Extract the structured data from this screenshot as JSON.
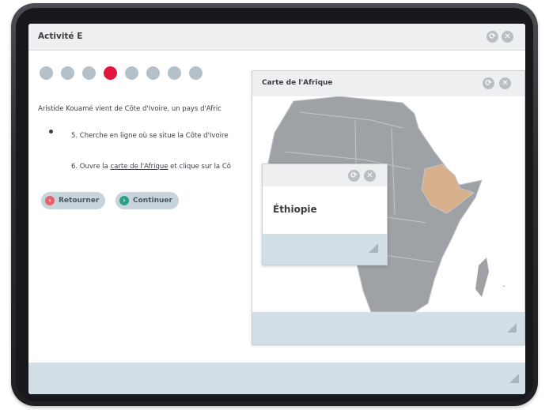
{
  "window": {
    "title": "Activité E",
    "refresh_symbol": "⟳",
    "close_symbol": "✕"
  },
  "progress": {
    "total_steps": 8,
    "current_step": 4,
    "active_color": "#e1163c",
    "inactive_color": "#b4c0ca"
  },
  "content": {
    "paragraph": "Aristide Kouamé vient de Côte d'Ivoire, un pays d'Afric",
    "step5": "5. Cherche en ligne où se situe la Côte d'Ivoire",
    "step6_prefix": "6. Ouvre la ",
    "step6_link": "carte de l'Afrique",
    "step6_suffix": " et clique sur la Cô"
  },
  "buttons": {
    "back_label": "Retourner",
    "back_icon": "back-icon",
    "back_color": "#e8606c",
    "continue_label": "Continuer",
    "continue_icon": "forward-icon",
    "continue_color": "#2aa08a"
  },
  "map_window": {
    "title": "Carte de l'Afrique",
    "land_color": "#9ea1a6",
    "highlight_color": "#d9b08c"
  },
  "info_popup": {
    "country": "Éthiopie"
  }
}
